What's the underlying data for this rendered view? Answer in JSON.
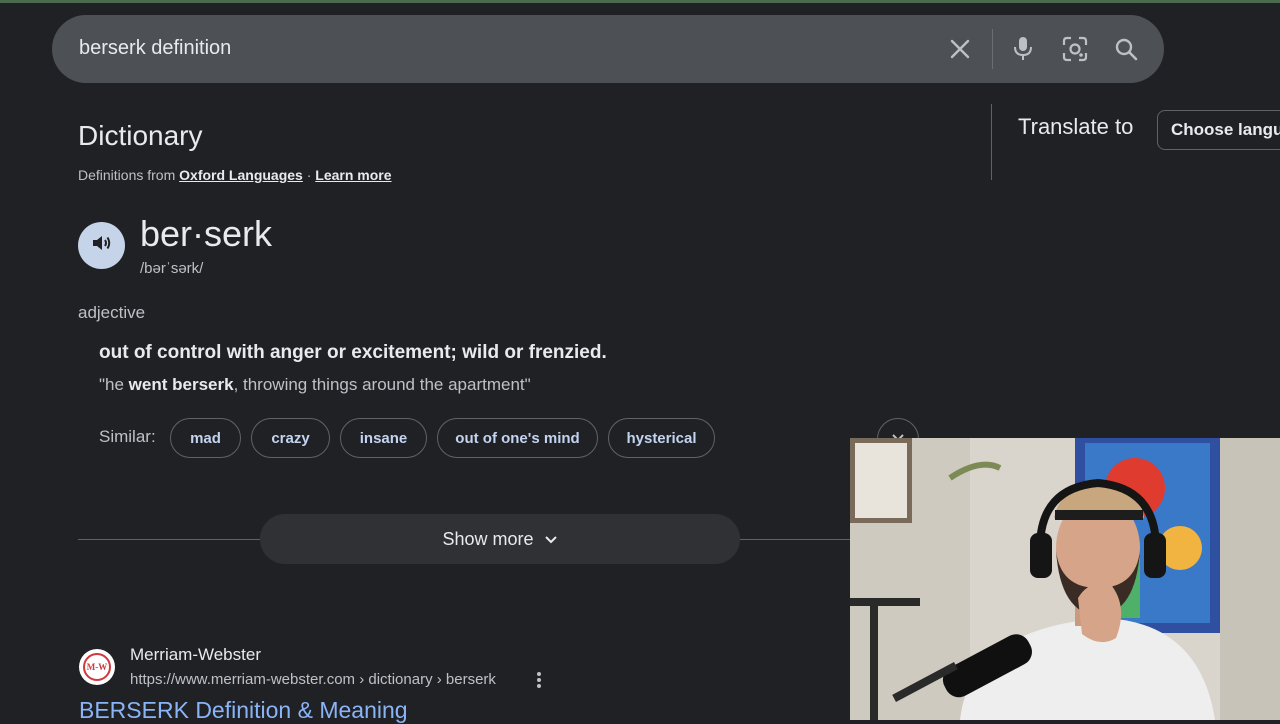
{
  "search": {
    "query": "berserk definition"
  },
  "dictionary": {
    "heading": "Dictionary",
    "source_prefix": "Definitions from",
    "source_link": "Oxford Languages",
    "separator": "·",
    "learn_more": "Learn more",
    "word": "ber·serk",
    "phonetic": "/bərˈsərk/",
    "part_of_speech": "adjective",
    "definition": "out of control with anger or excitement; wild or frenzied.",
    "example_open": "\"he ",
    "example_bold": "went berserk",
    "example_rest": ", throwing things around the apartment\"",
    "similar_label": "Similar:",
    "similar": [
      "mad",
      "crazy",
      "insane",
      "out of one's mind",
      "hysterical"
    ],
    "show_more": "Show more"
  },
  "translate": {
    "label": "Translate to",
    "select_value": "Choose language"
  },
  "result": {
    "favicon_text": "M-W",
    "site_name": "Merriam-Webster",
    "url": "https://www.merriam-webster.com › dictionary › berserk",
    "title": "BERSERK Definition & Meaning"
  },
  "icons": {
    "clear": "close-icon",
    "voice": "mic-icon",
    "lens": "camera-lens-icon",
    "search": "search-icon",
    "speaker": "speaker-icon",
    "expand": "chevron-down-icon",
    "menu": "more-vert-icon"
  },
  "colors": {
    "background": "#202124",
    "searchbar": "#4d5156",
    "link": "#8ab4f8",
    "chip_text": "#c2d4f0",
    "speaker_bg": "#c5d4e8"
  }
}
